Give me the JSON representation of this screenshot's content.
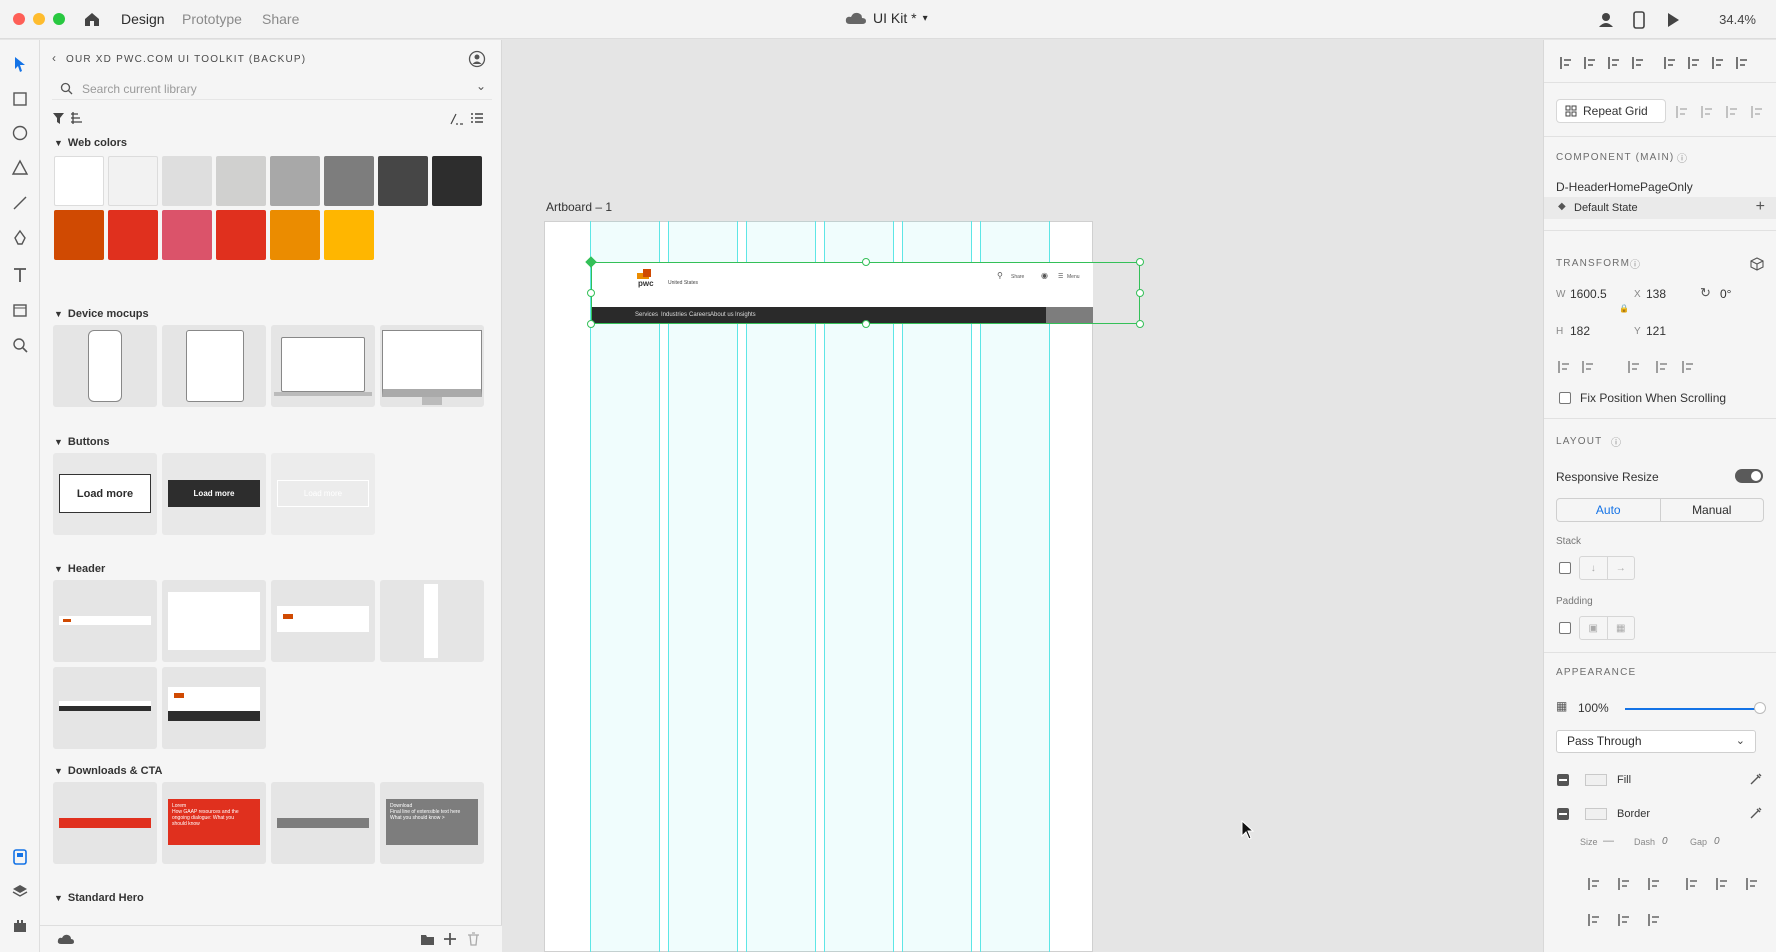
{
  "titlebar": {
    "tabs": [
      "Design",
      "Prototype",
      "Share"
    ],
    "active_tab": "Design",
    "doc_title": "UI Kit *",
    "zoom": "34.4%"
  },
  "library": {
    "title": "OUR XD PWC.COM UI TOOLKIT (BACKUP)",
    "search_placeholder": "Search current library",
    "sections": {
      "web_colors": "Web colors",
      "device_mocups": "Device mocups",
      "buttons": "Buttons",
      "header": "Header",
      "downloads_cta": "Downloads & CTA",
      "standard_hero": "Standard Hero"
    },
    "colors": [
      "#ffffff",
      "#f2f2f2",
      "#dedede",
      "#d0d0cf",
      "#a8a8a8",
      "#7d7d7d",
      "#464646",
      "#2d2d2d",
      "#d04a02",
      "#e0301e",
      "#db536a",
      "#e0301e",
      "#eb8c00",
      "#ffb600"
    ],
    "buttons": {
      "load_more_1": "Load more",
      "load_more_2": "Load more",
      "load_more_3": "Load more"
    },
    "cta": {
      "cta2_line1": "Lorem",
      "cta2_line2": "How GAAP resources and the",
      "cta2_line3": "ongoing dialogue: What you",
      "cta2_line4": "should know",
      "cta4_line1": "Download",
      "cta4_line2": "Final line of extensible text here",
      "cta4_line3": "What you should know >"
    }
  },
  "canvas": {
    "artboard_label": "Artboard – 1",
    "header_preview": {
      "brand": "pwc",
      "country": "United States",
      "share": "Share",
      "menu": "Menu",
      "nav": [
        "Services",
        "Industries",
        "Careers",
        "About us",
        "Insights"
      ]
    }
  },
  "properties": {
    "repeat_grid": "Repeat Grid",
    "component_heading": "COMPONENT (MAIN)",
    "component_name": "D-HeaderHomePageOnly",
    "state": "Default State",
    "transform_heading": "TRANSFORM",
    "w_label": "W",
    "w": "1600.5",
    "x_label": "X",
    "x": "138",
    "rot": "0°",
    "h_label": "H",
    "h": "182",
    "y_label": "Y",
    "y": "121",
    "fix_position": "Fix Position When Scrolling",
    "layout_heading": "LAYOUT",
    "responsive_resize": "Responsive Resize",
    "auto": "Auto",
    "manual": "Manual",
    "stack": "Stack",
    "padding": "Padding",
    "appearance_heading": "APPEARANCE",
    "opacity": "100%",
    "opacity_value": 1.0,
    "blend_mode": "Pass Through",
    "fill": "Fill",
    "border": "Border",
    "size_label": "Size",
    "dash_label": "Dash",
    "dash_value": "0",
    "gap_label": "Gap",
    "gap_value": "0"
  }
}
